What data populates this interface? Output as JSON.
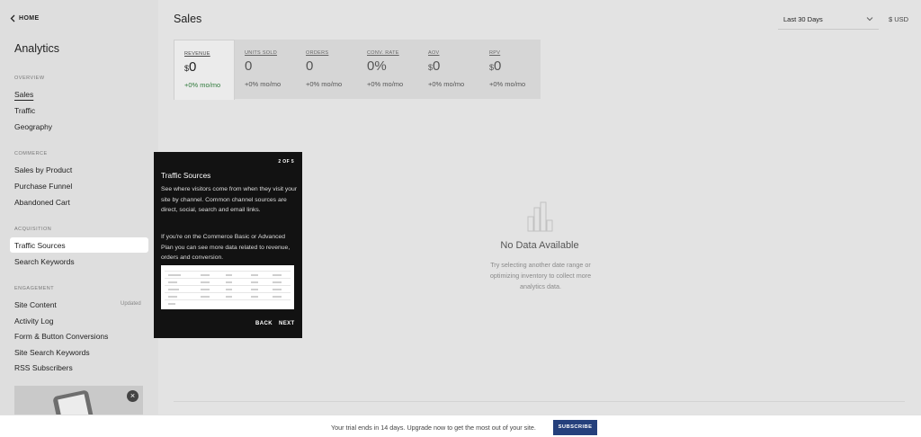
{
  "sidebar": {
    "home_label": "HOME",
    "title": "Analytics",
    "sections": {
      "overview": "OVERVIEW",
      "commerce": "COMMERCE",
      "acquisition": "ACQUISITION",
      "engagement": "ENGAGEMENT"
    },
    "items": {
      "sales": "Sales",
      "traffic": "Traffic",
      "geography": "Geography",
      "sales_by_product": "Sales by Product",
      "purchase_funnel": "Purchase Funnel",
      "abandoned_cart": "Abandoned Cart",
      "traffic_sources": "Traffic Sources",
      "search_keywords": "Search Keywords",
      "site_content": "Site Content",
      "activity_log": "Activity Log",
      "form_button_conversions": "Form & Button Conversions",
      "site_search_keywords": "Site Search Keywords",
      "rss_subscribers": "RSS Subscribers"
    },
    "updated_badge": "Updated",
    "active_item": "sales",
    "highlighted_item": "traffic_sources"
  },
  "header": {
    "title": "Sales",
    "date_range": "Last 30 Days",
    "currency": "$ USD"
  },
  "metrics": [
    {
      "label": "REVENUE",
      "prefix": "$",
      "value": "0",
      "change": "+0% mo/mo",
      "active": true
    },
    {
      "label": "UNITS SOLD",
      "prefix": "",
      "value": "0",
      "change": "+0% mo/mo",
      "active": false
    },
    {
      "label": "ORDERS",
      "prefix": "",
      "value": "0",
      "change": "+0% mo/mo",
      "active": false
    },
    {
      "label": "CONV. RATE",
      "prefix": "",
      "value": "0%",
      "change": "+0% mo/mo",
      "active": false
    },
    {
      "label": "AOV",
      "prefix": "$",
      "value": "0",
      "change": "+0% mo/mo",
      "active": false
    },
    {
      "label": "RPV",
      "prefix": "$",
      "value": "0",
      "change": "+0% mo/mo",
      "active": false
    }
  ],
  "empty_state": {
    "title": "No Data Available",
    "text": "Try selecting another date range or optimizing inventory to collect more analytics data."
  },
  "tooltip": {
    "step": "2 OF 5",
    "title": "Traffic Sources",
    "paragraph1": "See where visitors come from when they visit your site by channel. Common channel sources are direct, social, search and email links.",
    "paragraph2": "If you're on the Commerce Basic or Advanced Plan you can see more data related to revenue, orders and conversion.",
    "back_label": "BACK",
    "next_label": "NEXT"
  },
  "trial_banner": {
    "text": "Your trial ends in 14 days. Upgrade now to get the most out of your site.",
    "button_label": "SUBSCRIBE"
  },
  "colors": {
    "accent_button": "#25407c",
    "positive_change": "#2f7a3b",
    "tooltip_bg": "#121212"
  }
}
